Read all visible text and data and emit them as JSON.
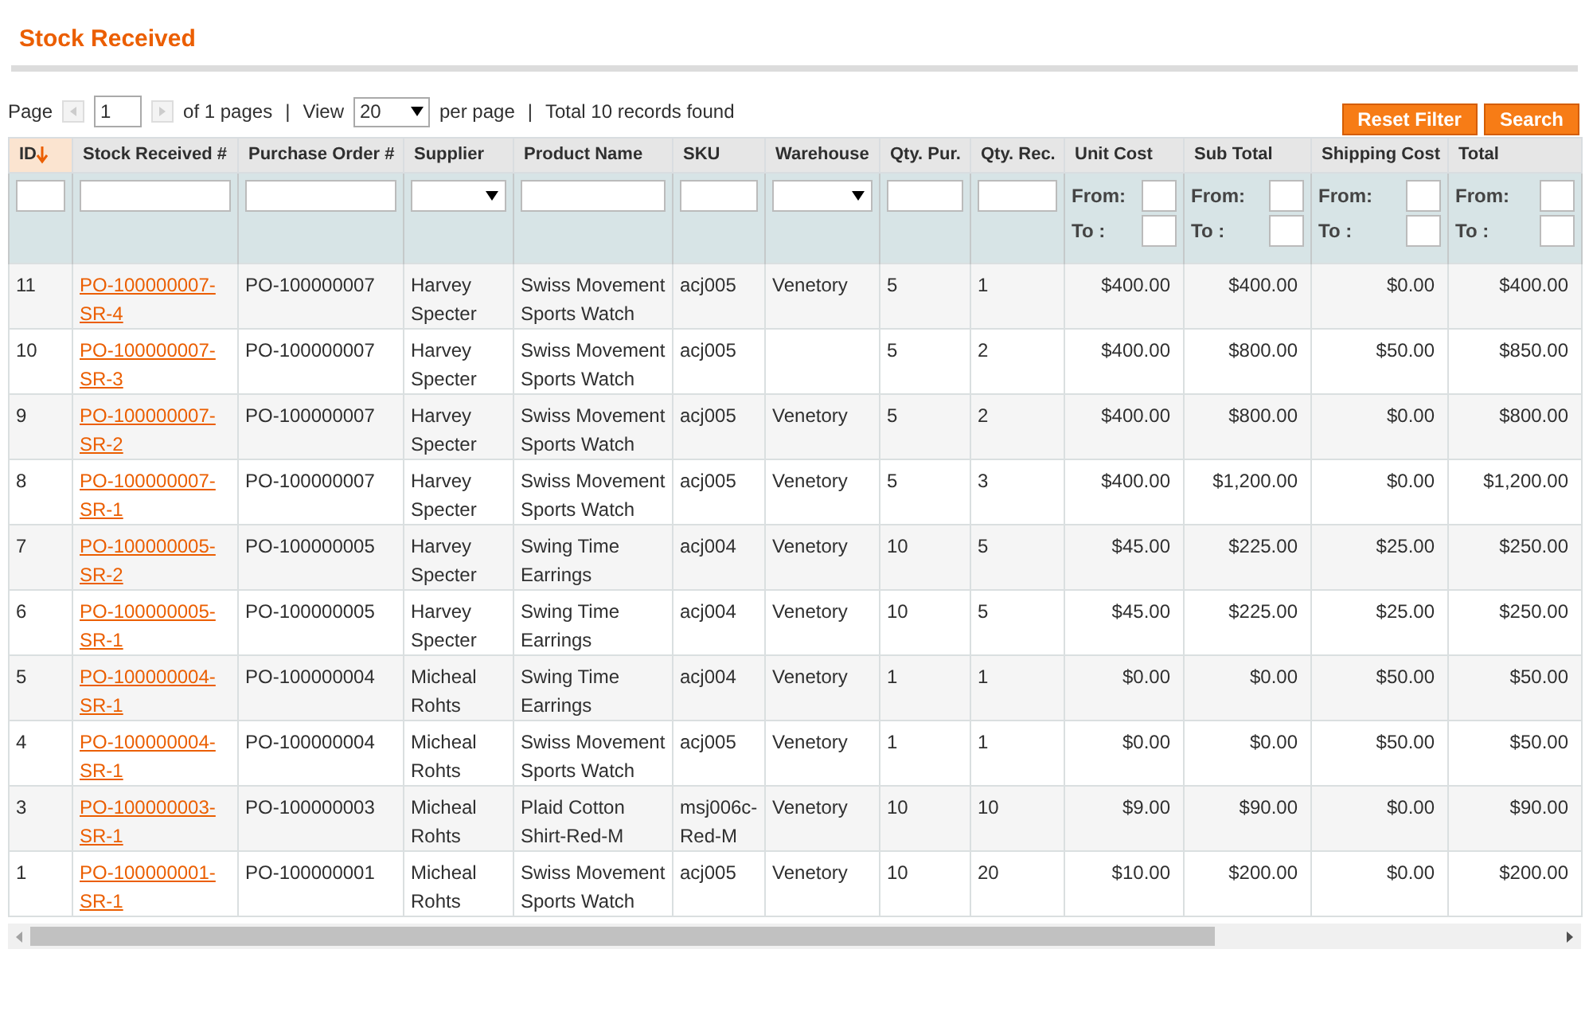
{
  "page_title": "Stock Received",
  "pager": {
    "page_label": "Page",
    "page_value": "1",
    "of_pages": "of 1 pages",
    "separator_1": "|",
    "view_label": "View",
    "per_page_value": "20",
    "per_page_label": "per page",
    "separator_2": "|",
    "total": "Total 10 records found"
  },
  "buttons": [
    "Reset Filter",
    "Search"
  ],
  "table": {
    "columns": [
      {
        "label": "ID",
        "sorted": true,
        "kind": "text",
        "filter": {
          "kind": "input"
        }
      },
      {
        "label": "Stock Received #",
        "sorted": false,
        "kind": "link",
        "filter": {
          "kind": "input"
        }
      },
      {
        "label": "Purchase Order #",
        "sorted": false,
        "kind": "text",
        "filter": {
          "kind": "input"
        }
      },
      {
        "label": "Supplier",
        "sorted": false,
        "kind": "text",
        "filter": {
          "kind": "dropdown"
        }
      },
      {
        "label": "Product Name",
        "sorted": false,
        "kind": "text",
        "filter": {
          "kind": "input"
        }
      },
      {
        "label": "SKU",
        "sorted": false,
        "kind": "text",
        "filter": {
          "kind": "input"
        }
      },
      {
        "label": "Warehouse",
        "sorted": false,
        "kind": "text",
        "filter": {
          "kind": "dropdown"
        }
      },
      {
        "label": "Qty. Pur.",
        "sorted": false,
        "kind": "text",
        "filter": {
          "kind": "input"
        }
      },
      {
        "label": "Qty. Rec.",
        "sorted": false,
        "kind": "text",
        "filter": {
          "kind": "input"
        }
      },
      {
        "label": "Unit Cost",
        "sorted": false,
        "kind": "money",
        "filter": {
          "kind": "range",
          "from": "From:",
          "to": "To :"
        }
      },
      {
        "label": "Sub Total",
        "sorted": false,
        "kind": "money",
        "filter": {
          "kind": "range",
          "from": "From:",
          "to": "To :"
        }
      },
      {
        "label": "Shipping Cost",
        "sorted": false,
        "kind": "money",
        "filter": {
          "kind": "range",
          "from": "From:",
          "to": "To :"
        }
      },
      {
        "label": "Total",
        "sorted": false,
        "kind": "money",
        "filter": {
          "kind": "range",
          "from": "From:",
          "to": "To :"
        }
      }
    ],
    "rows": [
      [
        "11",
        "PO-100000007-SR-4",
        "PO-100000007",
        "Harvey Specter",
        "Swiss Movement Sports Watch",
        "acj005",
        "Venetory",
        "5",
        "1",
        "$400.00",
        "$400.00",
        "$0.00",
        "$400.00"
      ],
      [
        "10",
        "PO-100000007-SR-3",
        "PO-100000007",
        "Harvey Specter",
        "Swiss Movement Sports Watch",
        "acj005",
        null,
        "5",
        "2",
        "$400.00",
        "$800.00",
        "$50.00",
        "$850.00"
      ],
      [
        "9",
        "PO-100000007-SR-2",
        "PO-100000007",
        "Harvey Specter",
        "Swiss Movement Sports Watch",
        "acj005",
        "Venetory",
        "5",
        "2",
        "$400.00",
        "$800.00",
        "$0.00",
        "$800.00"
      ],
      [
        "8",
        "PO-100000007-SR-1",
        "PO-100000007",
        "Harvey Specter",
        "Swiss Movement Sports Watch",
        "acj005",
        "Venetory",
        "5",
        "3",
        "$400.00",
        "$1,200.00",
        "$0.00",
        "$1,200.00"
      ],
      [
        "7",
        "PO-100000005-SR-2",
        "PO-100000005",
        "Harvey Specter",
        "Swing Time Earrings",
        "acj004",
        "Venetory",
        "10",
        "5",
        "$45.00",
        "$225.00",
        "$25.00",
        "$250.00"
      ],
      [
        "6",
        "PO-100000005-SR-1",
        "PO-100000005",
        "Harvey Specter",
        "Swing Time Earrings",
        "acj004",
        "Venetory",
        "10",
        "5",
        "$45.00",
        "$225.00",
        "$25.00",
        "$250.00"
      ],
      [
        "5",
        "PO-100000004-SR-1",
        "PO-100000004",
        "Micheal Rohts",
        "Swing Time Earrings",
        "acj004",
        "Venetory",
        "1",
        "1",
        "$0.00",
        "$0.00",
        "$50.00",
        "$50.00"
      ],
      [
        "4",
        "PO-100000004-SR-1",
        "PO-100000004",
        "Micheal Rohts",
        "Swiss Movement Sports Watch",
        "acj005",
        "Venetory",
        "1",
        "1",
        "$0.00",
        "$0.00",
        "$50.00",
        "$50.00"
      ],
      [
        "3",
        "PO-100000003-SR-1",
        "PO-100000003",
        "Micheal Rohts",
        "Plaid Cotton Shirt-Red-M",
        "msj006c-Red-M",
        "Venetory",
        "10",
        "10",
        "$9.00",
        "$90.00",
        "$0.00",
        "$90.00"
      ],
      [
        "1",
        "PO-100000001-SR-1",
        "PO-100000001",
        "Micheal Rohts",
        "Swiss Movement Sports Watch",
        "acj005",
        "Venetory",
        "10",
        "20",
        "$10.00",
        "$200.00",
        "$0.00",
        "$200.00"
      ]
    ]
  }
}
